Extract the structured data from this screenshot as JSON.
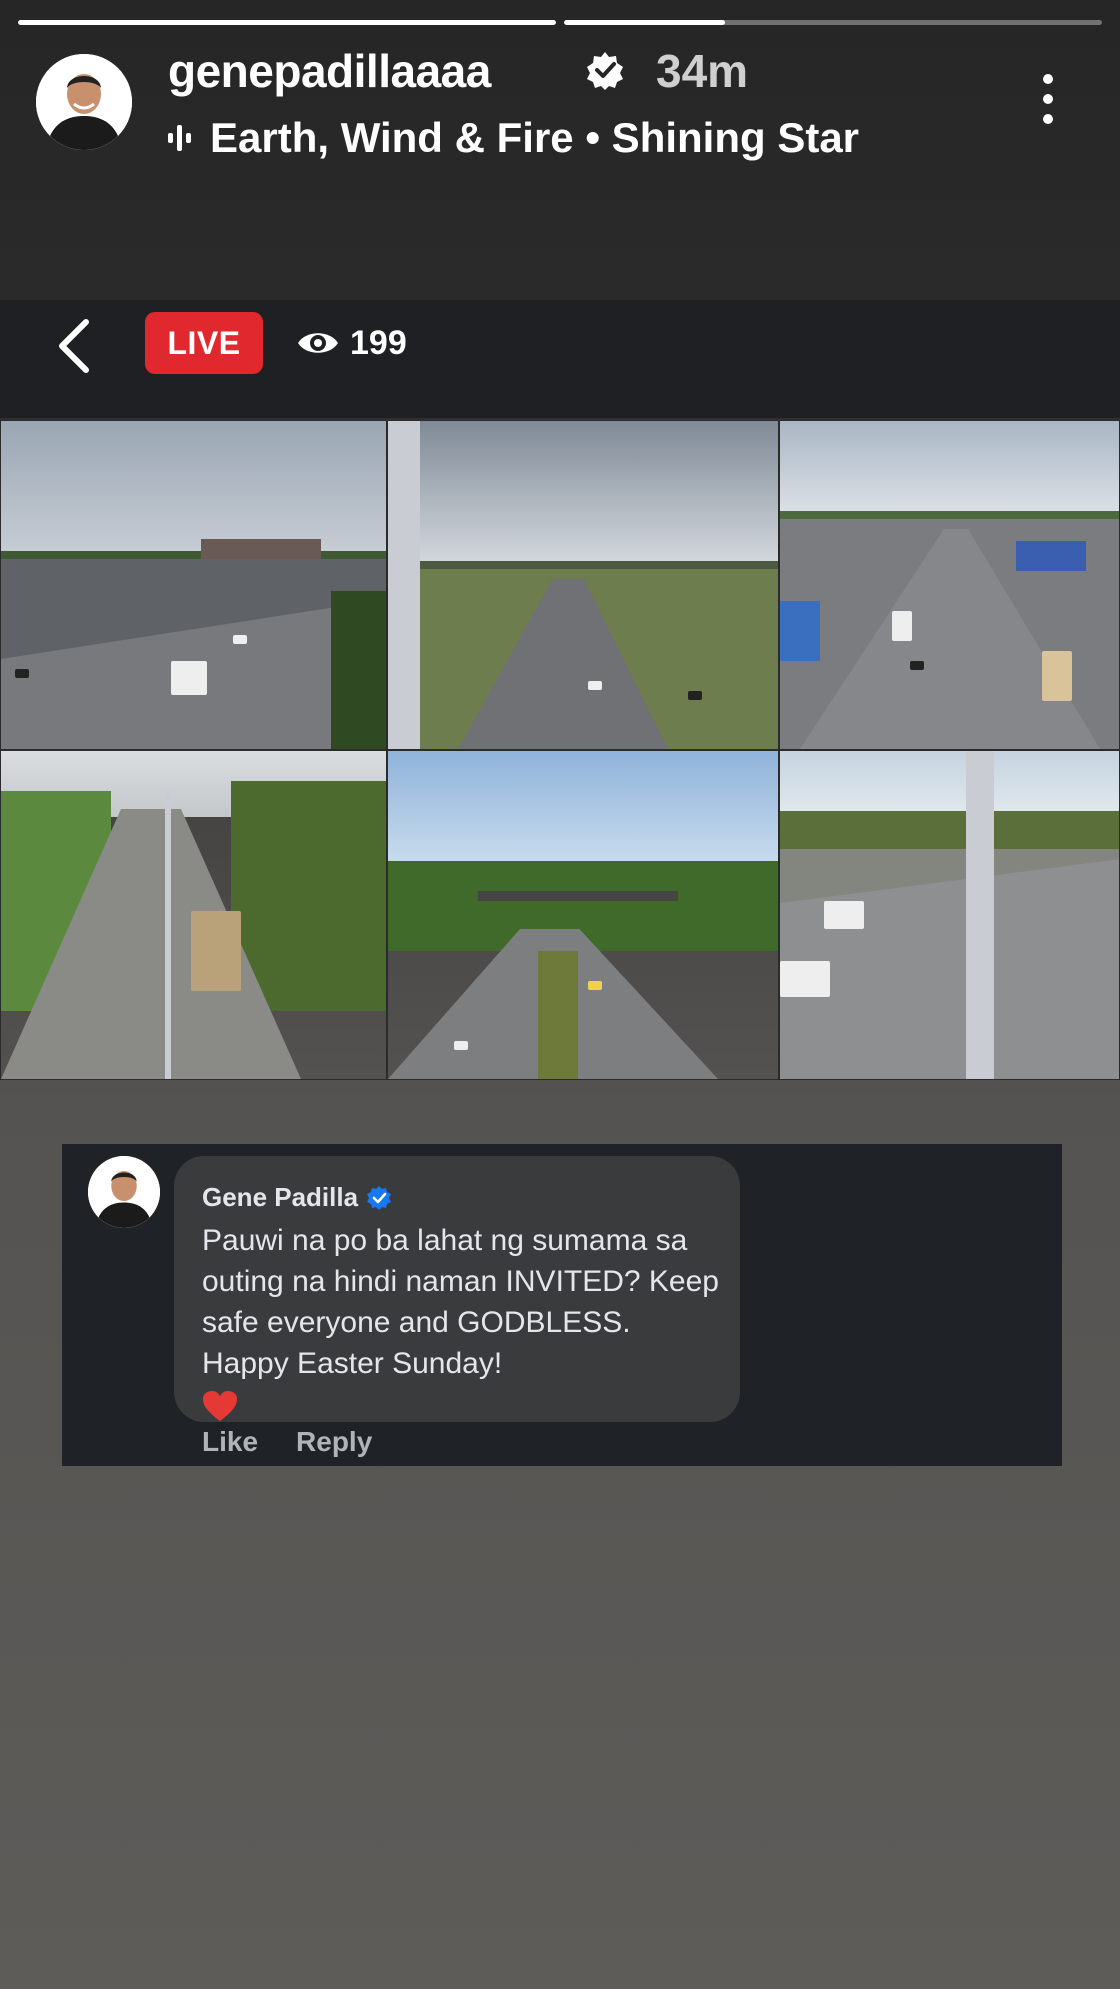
{
  "story": {
    "progress": [
      1.0,
      0.3
    ],
    "username": "genepadillaaaa",
    "time_ago": "34m",
    "music": "Earth, Wind & Fire • Shining Star",
    "icons": {
      "verified": "verified-badge-icon",
      "music": "music-bars-icon",
      "more": "more-vertical-icon"
    }
  },
  "live": {
    "badge": "LIVE",
    "viewers": "199",
    "icons": {
      "back": "back-chevron-icon",
      "eye": "eye-icon"
    }
  },
  "comment": {
    "author": "Gene Padilla",
    "text": "Pauwi na po ba lahat ng sumama sa outing na hindi naman INVITED? Keep safe everyone and GODBLESS. Happy Easter Sunday!",
    "actions": {
      "like": "Like",
      "reply": "Reply"
    },
    "colors": {
      "bubble": "#3a3b3c",
      "verified": "#1877f2",
      "heart": "#e53935"
    }
  },
  "colors": {
    "live_red": "#e0282e"
  }
}
